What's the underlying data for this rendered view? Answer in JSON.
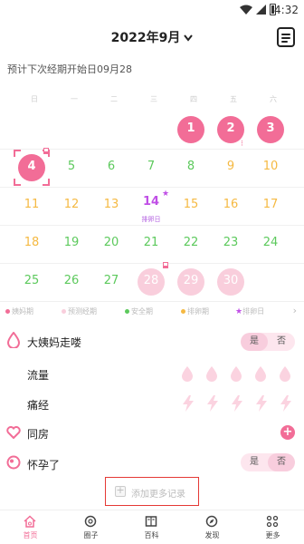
{
  "status": {
    "time": "4:32"
  },
  "header": {
    "title": "2022年9月"
  },
  "forecast": "预计下次经期开始日09月28",
  "weekdays": [
    "日",
    "一",
    "二",
    "三",
    "四",
    "五",
    "六"
  ],
  "calendar": {
    "rows": [
      [
        null,
        null,
        null,
        null,
        {
          "d": "1",
          "t": "period"
        },
        {
          "d": "2",
          "t": "period"
        },
        {
          "d": "3",
          "t": "period"
        }
      ],
      [
        {
          "d": "4",
          "t": "period"
        },
        {
          "d": "5",
          "t": "safe"
        },
        {
          "d": "6",
          "t": "safe"
        },
        {
          "d": "7",
          "t": "safe"
        },
        {
          "d": "8",
          "t": "safe"
        },
        {
          "d": "9",
          "t": "ov"
        },
        {
          "d": "10",
          "t": "ov"
        }
      ],
      [
        {
          "d": "11",
          "t": "ov"
        },
        {
          "d": "12",
          "t": "ov"
        },
        {
          "d": "13",
          "t": "ov"
        },
        {
          "d": "14",
          "t": "ovday",
          "sub": "排卵日"
        },
        {
          "d": "15",
          "t": "ov"
        },
        {
          "d": "16",
          "t": "ov"
        },
        {
          "d": "17",
          "t": "ov"
        }
      ],
      [
        {
          "d": "18",
          "t": "ov"
        },
        {
          "d": "19",
          "t": "safe"
        },
        {
          "d": "20",
          "t": "safe"
        },
        {
          "d": "21",
          "t": "safe"
        },
        {
          "d": "22",
          "t": "safe"
        },
        {
          "d": "23",
          "t": "safe"
        },
        {
          "d": "24",
          "t": "safe"
        }
      ],
      [
        {
          "d": "25",
          "t": "safe"
        },
        {
          "d": "26",
          "t": "safe"
        },
        {
          "d": "27",
          "t": "safe"
        },
        {
          "d": "28",
          "t": "predict"
        },
        {
          "d": "29",
          "t": "predict"
        },
        {
          "d": "30",
          "t": "predict"
        },
        null
      ]
    ]
  },
  "legend": [
    {
      "label": "姨妈期",
      "color": "#f26d97"
    },
    {
      "label": "预测经期",
      "color": "#f9cedc"
    },
    {
      "label": "安全期",
      "color": "#5cc95c"
    },
    {
      "label": "排卵期",
      "color": "#f5b942"
    },
    {
      "label": "排卵日",
      "color": "#c04fe6"
    }
  ],
  "records": {
    "period_label": "大姨妈走喽",
    "yes": "是",
    "no": "否",
    "flow_label": "流量",
    "pain_label": "痛经",
    "sex_label": "同房",
    "pregnant_label": "怀孕了"
  },
  "add_more": "添加更多记录",
  "tabs": [
    {
      "label": "首页",
      "icon": "home-icon"
    },
    {
      "label": "圈子",
      "icon": "circle-icon"
    },
    {
      "label": "百科",
      "icon": "book-icon"
    },
    {
      "label": "发现",
      "icon": "compass-icon"
    },
    {
      "label": "更多",
      "icon": "grid-icon"
    }
  ],
  "colors": {
    "accent": "#f26d97",
    "accent_light": "#f9cedc",
    "safe": "#5cc95c",
    "ovulation": "#f5b942",
    "ovulation_day": "#c04fe6"
  }
}
